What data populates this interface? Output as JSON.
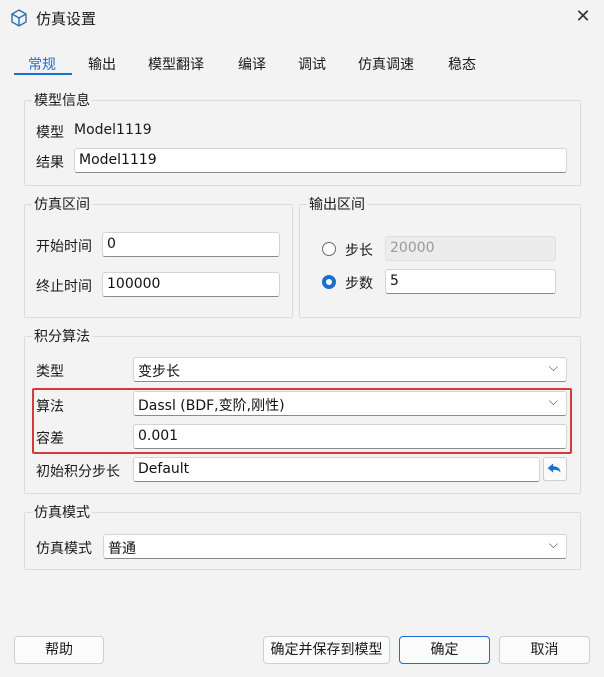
{
  "window": {
    "title": "仿真设置"
  },
  "tabs": [
    {
      "label": "常规"
    },
    {
      "label": "输出"
    },
    {
      "label": "模型翻译"
    },
    {
      "label": "编译"
    },
    {
      "label": "调试"
    },
    {
      "label": "仿真调速"
    },
    {
      "label": "稳态"
    }
  ],
  "model_info": {
    "legend": "模型信息",
    "model_label": "模型",
    "model_value": "Model1119",
    "result_label": "结果",
    "result_value": "Model1119"
  },
  "sim_interval": {
    "legend": "仿真区间",
    "start_label": "开始时间",
    "start_value": "0",
    "stop_label": "终止时间",
    "stop_value": "100000"
  },
  "output_interval": {
    "legend": "输出区间",
    "step_label": "步长",
    "step_value": "20000",
    "count_label": "步数",
    "count_value": "5"
  },
  "integration": {
    "legend": "积分算法",
    "type_label": "类型",
    "type_value": "变步长",
    "algorithm_label": "算法",
    "algorithm_value": "Dassl (BDF,变阶,刚性)",
    "tolerance_label": "容差",
    "tolerance_value": "0.001",
    "initial_step_label": "初始积分步长",
    "initial_step_value": "Default"
  },
  "sim_mode": {
    "legend": "仿真模式",
    "mode_label": "仿真模式",
    "mode_value": "普通"
  },
  "buttons": {
    "help": "帮助",
    "save_model": "确定并保存到模型",
    "ok": "确定",
    "cancel": "取消"
  },
  "colors": {
    "accent": "#1a6fd0",
    "highlight": "#d33a3a"
  }
}
